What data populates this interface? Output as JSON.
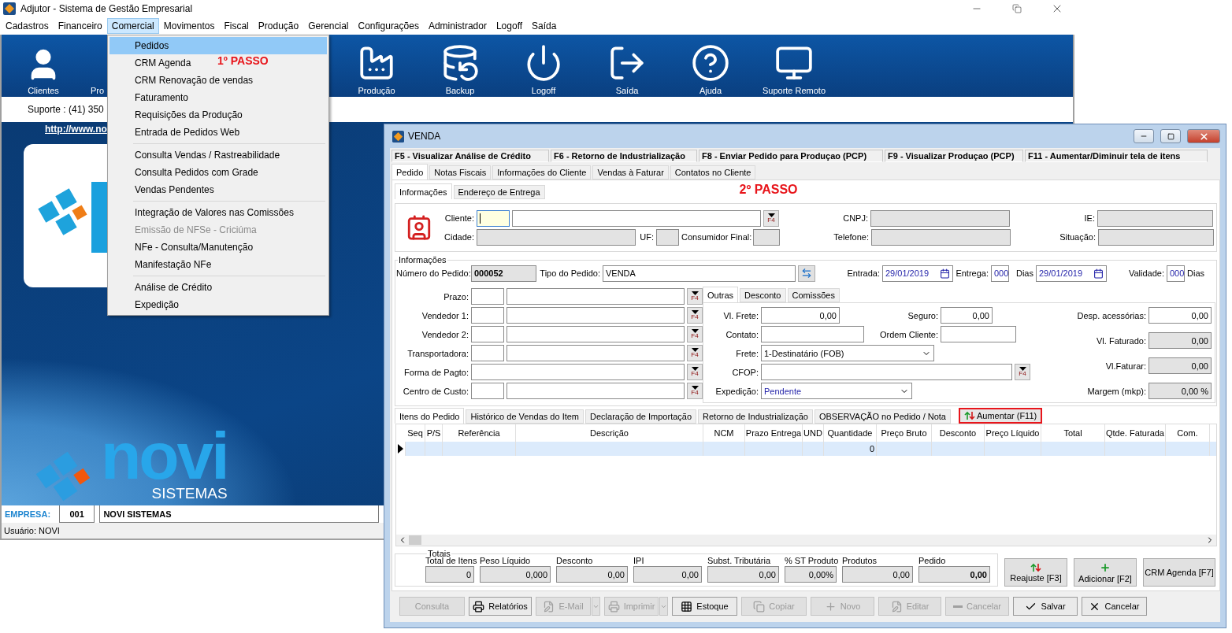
{
  "window": {
    "title": "Adjutor - Sistema de Gestão Empresarial"
  },
  "menu": [
    {
      "label": "Cadastros",
      "selected": false
    },
    {
      "label": "Financeiro",
      "selected": false
    },
    {
      "label": "Comercial",
      "selected": true
    },
    {
      "label": "Movimentos",
      "selected": false
    },
    {
      "label": "Fiscal",
      "selected": false
    },
    {
      "label": "Produção",
      "selected": false
    },
    {
      "label": "Gerencial",
      "selected": false
    },
    {
      "label": "Configurações",
      "selected": false
    },
    {
      "label": "Administrador",
      "selected": false
    },
    {
      "label": "Logoff",
      "selected": false
    },
    {
      "label": "Saída",
      "selected": false
    }
  ],
  "toolbar": {
    "left": [
      {
        "label": "Clientes"
      },
      {
        "label": "Pro"
      }
    ],
    "right": [
      {
        "label": "Produção"
      },
      {
        "label": "Backup"
      },
      {
        "label": "Logoff"
      },
      {
        "label": "Saída"
      },
      {
        "label": "Ajuda"
      },
      {
        "label": "Suporte Remoto"
      }
    ]
  },
  "support": "Suporte : (41) 350",
  "link": "http://www.no",
  "logo": {
    "name": "novi",
    "tagline": "SISTEMAS"
  },
  "company": {
    "label": "EMPRESA:",
    "code": "001",
    "name": "NOVI SISTEMAS"
  },
  "status_bar": "Usuário: NOVI",
  "dropdown": {
    "annotation": "1º PASSO",
    "sections": [
      {
        "items": [
          {
            "label": "Pedidos",
            "selected": true,
            "disabled": false
          },
          {
            "label": "CRM Agenda",
            "selected": false,
            "disabled": false
          },
          {
            "label": "CRM Renovação de vendas",
            "selected": false,
            "disabled": false
          },
          {
            "label": "Faturamento",
            "selected": false,
            "disabled": false
          },
          {
            "label": "Requisições da Produção",
            "selected": false,
            "disabled": false
          },
          {
            "label": "Entrada de Pedidos Web",
            "selected": false,
            "disabled": false
          }
        ]
      },
      {
        "items": [
          {
            "label": "Consulta Vendas / Rastreabilidade",
            "selected": false,
            "disabled": false
          },
          {
            "label": "Consulta Pedidos com Grade",
            "selected": false,
            "disabled": false
          },
          {
            "label": "Vendas Pendentes",
            "selected": false,
            "disabled": false
          }
        ]
      },
      {
        "items": [
          {
            "label": "Integração de Valores nas Comissões",
            "selected": false,
            "disabled": false
          },
          {
            "label": "Emissão de NFSe - Criciúma",
            "selected": false,
            "disabled": true
          },
          {
            "label": "NFe - Consulta/Manutenção",
            "selected": false,
            "disabled": false
          },
          {
            "label": "Manifestação NFe",
            "selected": false,
            "disabled": false
          }
        ]
      },
      {
        "items": [
          {
            "label": "Análise de Crédito",
            "selected": false,
            "disabled": false
          },
          {
            "label": "Expedição",
            "selected": false,
            "disabled": false
          }
        ]
      }
    ]
  },
  "venda": {
    "title": "VENDA",
    "shortcuts": [
      "F5 - Visualizar Análise de Crédito",
      "F6 - Retorno de Industrialização",
      "F8 - Enviar Pedido para Produçao (PCP)",
      "F9 - Visualizar Produçao (PCP)",
      "F11 - Aumentar/Diminuir tela de itens"
    ],
    "tabs": [
      {
        "label": "Pedido",
        "selected": true
      },
      {
        "label": "Notas Fiscais",
        "selected": false
      },
      {
        "label": "Informações do Cliente",
        "selected": false
      },
      {
        "label": "Vendas à Faturar",
        "selected": false
      },
      {
        "label": "Contatos no Cliente",
        "selected": false
      }
    ],
    "subtabs": [
      {
        "label": "Informações",
        "selected": true
      },
      {
        "label": "Endereço de Entrega",
        "selected": false
      }
    ],
    "annotation": "2º PASSO",
    "client": {
      "cliente": {
        "label": "Cliente:",
        "focused": true,
        "button": "F4"
      },
      "cidade": "Cidade:",
      "uf": "UF:",
      "consumidor_final": "Consumidor Final:",
      "cnpj": "CNPJ:",
      "telefone": "Telefone:",
      "ie": "IE:",
      "situacao": "Situação:"
    },
    "order": {
      "legend": "Informações",
      "numero": {
        "label": "Número do Pedido:",
        "value": "000052"
      },
      "tipo": {
        "label": "Tipo do Pedido:",
        "value": "VENDA"
      },
      "entrada": {
        "label": "Entrada:",
        "value": "29/01/2019"
      },
      "entrega": {
        "label": "Entrega:",
        "value": "000",
        "unit": "Dias",
        "date": "29/01/2019"
      },
      "validade": {
        "label": "Validade:",
        "value": "000",
        "unit": "Dias"
      },
      "lookups": [
        {
          "label": "Prazo:",
          "kind": "split",
          "button": "F4"
        },
        {
          "label": "Vendedor 1:",
          "kind": "split",
          "button": "F4"
        },
        {
          "label": "Vendedor 2:",
          "kind": "split",
          "button": "F4"
        },
        {
          "label": "Transportadora:",
          "kind": "split",
          "button": "F4"
        },
        {
          "label": "Forma de Pagto:",
          "kind": "single",
          "button": "F4"
        },
        {
          "label": "Centro de Custo:",
          "kind": "split",
          "button": "F4"
        }
      ],
      "side_tabs": [
        {
          "label": "Outras",
          "selected": true
        },
        {
          "label": "Desconto",
          "selected": false
        },
        {
          "label": "Comissões",
          "selected": false
        }
      ],
      "frete_valor": {
        "label": "Vl. Frete:",
        "value": "0,00"
      },
      "seguro": {
        "label": "Seguro:",
        "value": "0,00"
      },
      "contato": {
        "label": "Contato:"
      },
      "ordem_cliente": {
        "label": "Ordem Cliente:"
      },
      "frete": {
        "label": "Frete:",
        "value": "1-Destinatário (FOB)"
      },
      "cfop": {
        "label": "CFOP:",
        "button": "F4"
      },
      "expedicao": {
        "label": "Expedição:",
        "value": "Pendente"
      },
      "desp": {
        "label": "Desp. acessórias:",
        "value": "0,00"
      },
      "faturado": {
        "label": "Vl. Faturado:",
        "value": "0,00"
      },
      "faturar": {
        "label": "Vl.Faturar:",
        "value": "0,00"
      },
      "margem": {
        "label": "Margem (mkp):",
        "value": "0,00 %"
      }
    },
    "item_tabs": [
      {
        "label": "Itens do Pedido",
        "selected": true
      },
      {
        "label": "Histórico de Vendas do Item",
        "selected": false
      },
      {
        "label": "Declaração de Importação",
        "selected": false
      },
      {
        "label": "Retorno de Industrialização",
        "selected": false
      },
      {
        "label": "OBSERVAÇÃO no Pedido / Nota",
        "selected": false
      }
    ],
    "resize_button": {
      "label": "Aumentar (F11)",
      "highlighted": true
    },
    "grid": {
      "columns": [
        "Seq",
        "P/S",
        "Referência",
        "Descrição",
        "NCM",
        "Prazo Entrega",
        "UND",
        "Quantidade",
        "Preço Bruto",
        "Desconto",
        "Preço Líquido",
        "Total",
        "Qtde. Faturada",
        "Com."
      ],
      "rows": [
        {
          "selected": true,
          "quantidade": "0"
        }
      ]
    },
    "totals": {
      "legend": "Totais",
      "fields": [
        {
          "label": "Total de Itens",
          "value": "0",
          "bold": false
        },
        {
          "label": "Peso Líquido",
          "value": "0,000",
          "bold": false
        },
        {
          "label": "Desconto",
          "value": "0,00",
          "bold": false
        },
        {
          "label": "IPI",
          "value": "0,00",
          "bold": false
        },
        {
          "label": "Subst. Tributária",
          "value": "0,00",
          "bold": false
        },
        {
          "label": "% ST Produto",
          "value": "0,00%",
          "bold": false
        },
        {
          "label": "Produtos",
          "value": "0,00",
          "bold": false
        },
        {
          "label": "Pedido",
          "value": "0,00",
          "bold": true
        }
      ]
    },
    "side_buttons": [
      {
        "label": "Reajuste [F3]"
      },
      {
        "label": "Adicionar [F2]"
      },
      {
        "label": "CRM Agenda [F7]"
      }
    ],
    "actions": [
      {
        "label": "Consulta",
        "disabled": true,
        "dropdown": false
      },
      {
        "label": "Relatórios",
        "disabled": false,
        "dropdown": false
      },
      {
        "label": "E-Mail",
        "disabled": true,
        "dropdown": true
      },
      {
        "label": "Imprimir",
        "disabled": true,
        "dropdown": true
      },
      {
        "label": "Estoque",
        "disabled": false,
        "dropdown": false
      },
      {
        "label": "Copiar",
        "disabled": true,
        "dropdown": false
      },
      {
        "label": "Novo",
        "disabled": true,
        "dropdown": false
      },
      {
        "label": "Editar",
        "disabled": true,
        "dropdown": false
      },
      {
        "label": "Cancelar",
        "disabled": true,
        "dropdown": false
      },
      {
        "label": "Salvar",
        "disabled": false,
        "dropdown": false
      },
      {
        "label": "Cancelar",
        "disabled": false,
        "dropdown": false
      }
    ]
  }
}
